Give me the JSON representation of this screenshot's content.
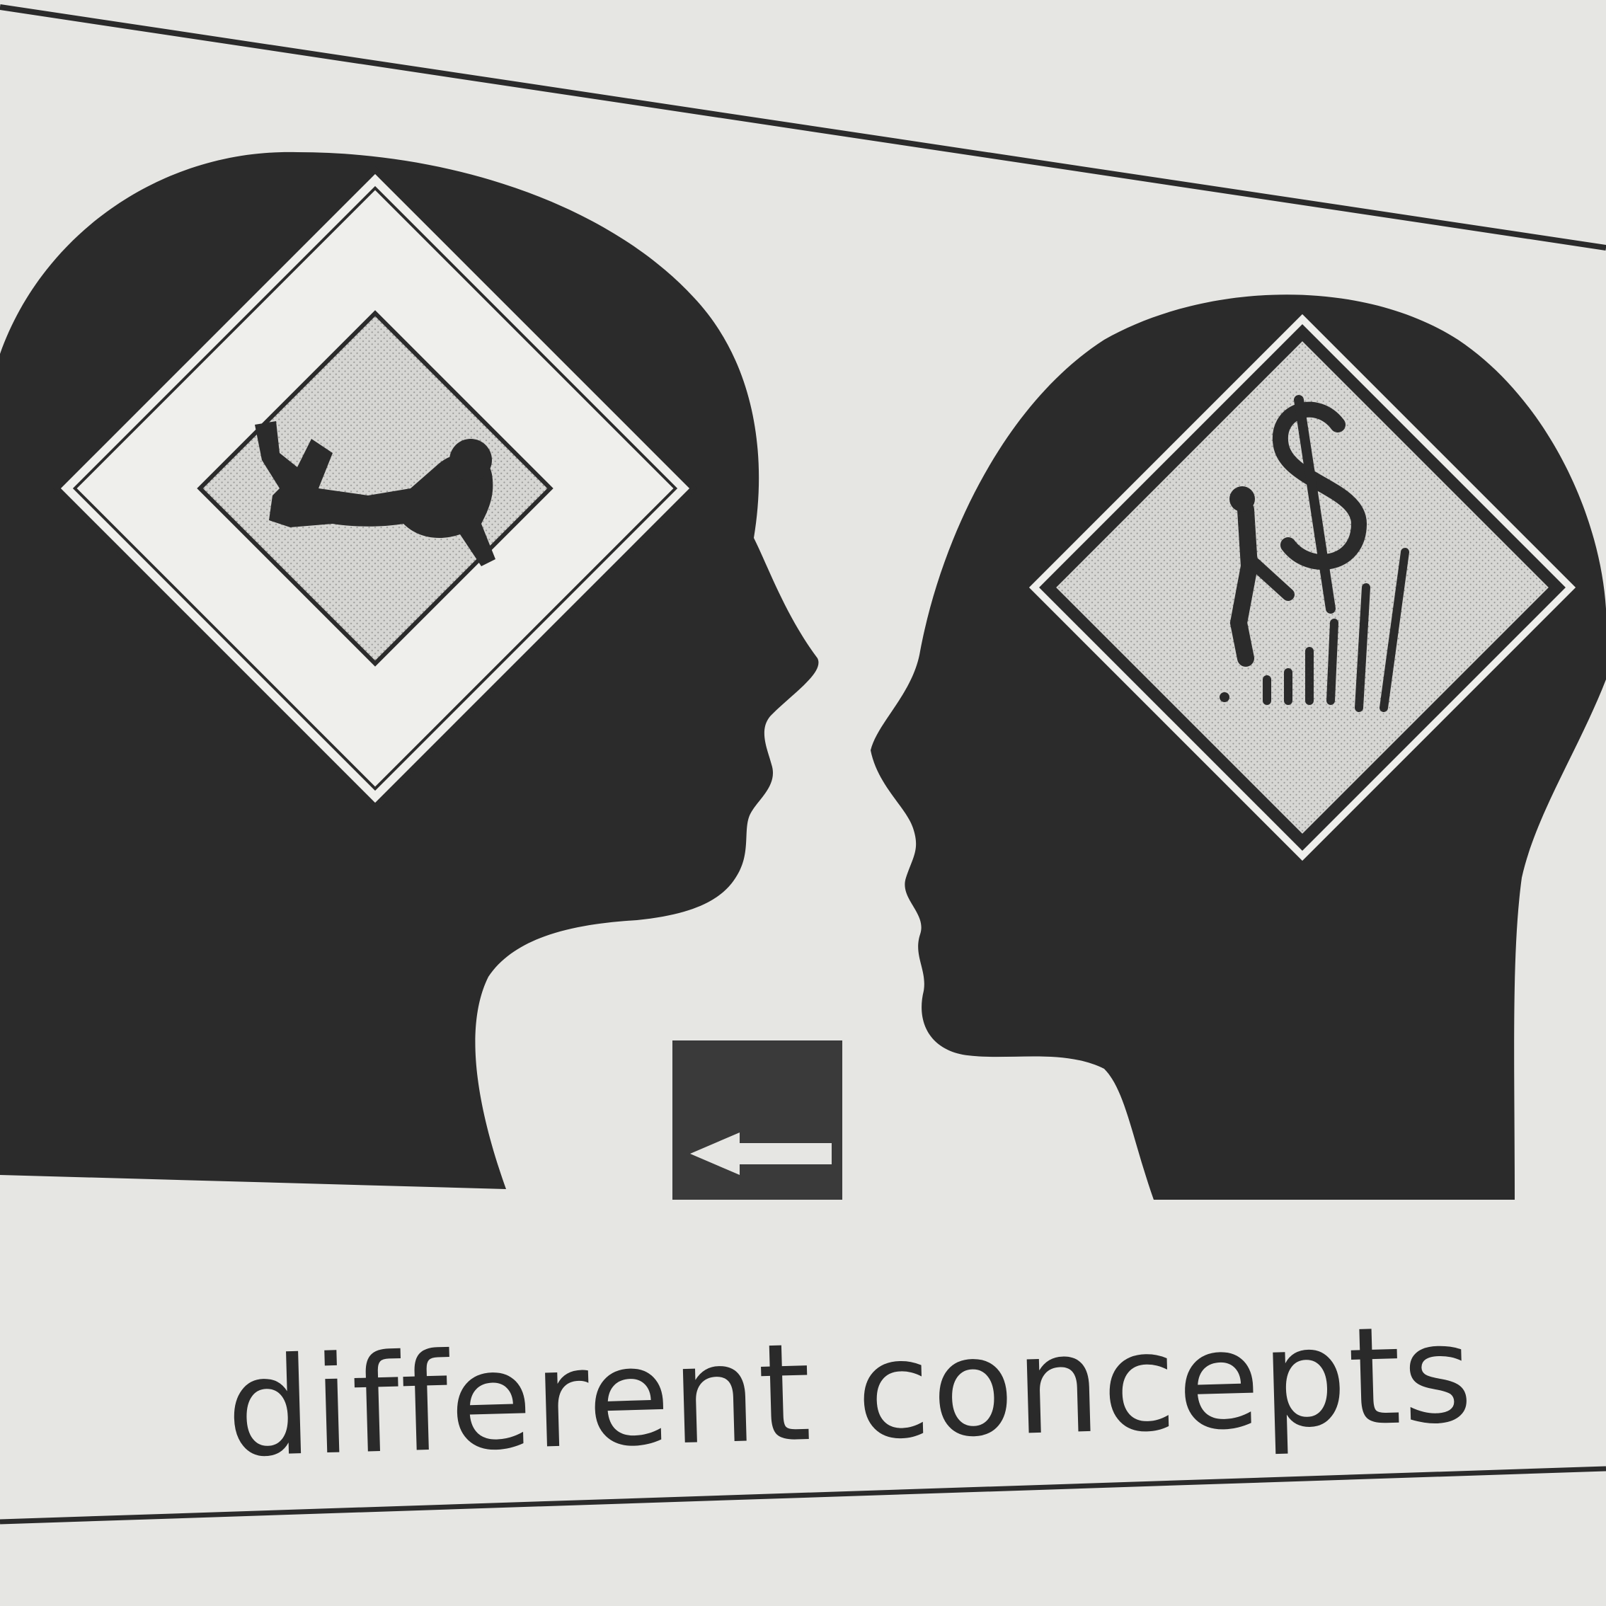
{
  "caption": "different concepts",
  "colors": {
    "paper": "#e6e6e3",
    "ink": "#2b2b2b",
    "sign_face": "#efefec",
    "sign_inner": "#d2d2cf"
  },
  "icons": {
    "left_head_sign": "falling-person-icon",
    "right_head_sign": "falling-dollar-icon",
    "center_box": "arrow-left-icon"
  }
}
